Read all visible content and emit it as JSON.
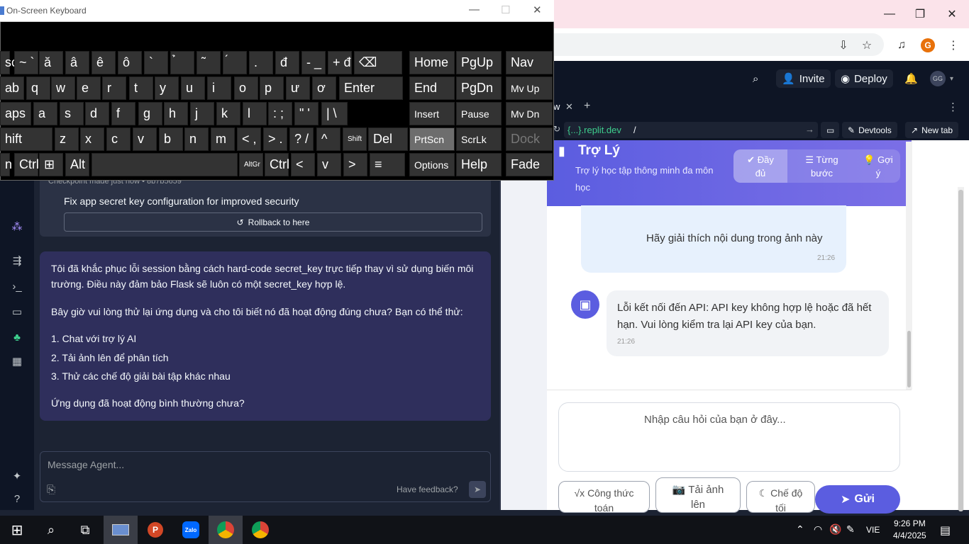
{
  "osk": {
    "title": "On-Screen Keyboard",
    "rows": [
      [
        {
          "l": "sc"
        },
        {
          "l": "~ `"
        },
        {
          "l": "ă"
        },
        {
          "l": "â"
        },
        {
          "l": "ê"
        },
        {
          "l": "ô"
        },
        {
          "l": "`"
        },
        {
          "l": "̉"
        },
        {
          "l": "̃"
        },
        {
          "l": "́"
        },
        {
          "l": "."
        },
        {
          "l": "đ"
        },
        {
          "l": "- _"
        },
        {
          "l": "+ đ"
        },
        {
          "l": "⌫"
        },
        {
          "l": "Home"
        },
        {
          "l": "PgUp"
        },
        {
          "l": "Nav"
        }
      ],
      [
        {
          "l": "ab"
        },
        {
          "l": "q"
        },
        {
          "l": "w"
        },
        {
          "l": "e"
        },
        {
          "l": "r"
        },
        {
          "l": "t"
        },
        {
          "l": "y"
        },
        {
          "l": "u"
        },
        {
          "l": "i"
        },
        {
          "l": "o"
        },
        {
          "l": "p"
        },
        {
          "l": "ư"
        },
        {
          "l": "ơ"
        },
        {
          "l": "Enter"
        },
        {
          "l": "End"
        },
        {
          "l": "PgDn"
        },
        {
          "l": "Mv Up"
        }
      ],
      [
        {
          "l": "aps"
        },
        {
          "l": "a"
        },
        {
          "l": "s"
        },
        {
          "l": "d"
        },
        {
          "l": "f"
        },
        {
          "l": "g"
        },
        {
          "l": "h"
        },
        {
          "l": "j"
        },
        {
          "l": "k"
        },
        {
          "l": "l"
        },
        {
          "l": ": ;"
        },
        {
          "l": "\" '"
        },
        {
          "l": "| \\"
        },
        {
          "l": "Insert"
        },
        {
          "l": "Pause"
        },
        {
          "l": "Mv Dn"
        }
      ],
      [
        {
          "l": "hift"
        },
        {
          "l": "z"
        },
        {
          "l": "x"
        },
        {
          "l": "c"
        },
        {
          "l": "v"
        },
        {
          "l": "b"
        },
        {
          "l": "n"
        },
        {
          "l": "m"
        },
        {
          "l": "< ,"
        },
        {
          "l": "> ."
        },
        {
          "l": "? /"
        },
        {
          "l": "^"
        },
        {
          "l": "Shift"
        },
        {
          "l": "Del"
        },
        {
          "l": "PrtScn"
        },
        {
          "l": "ScrLk"
        },
        {
          "l": "Dock"
        }
      ],
      [
        {
          "l": "n"
        },
        {
          "l": "Ctrl"
        },
        {
          "l": "⊞"
        },
        {
          "l": "Alt"
        },
        {
          "l": ""
        },
        {
          "l": "AltGr"
        },
        {
          "l": "Ctrl"
        },
        {
          "l": "<"
        },
        {
          "l": "v"
        },
        {
          "l": ">"
        },
        {
          "l": "≡"
        },
        {
          "l": "Options"
        },
        {
          "l": "Help"
        },
        {
          "l": "Fade"
        }
      ]
    ]
  },
  "chrome": {
    "minimize": "—",
    "maximize": "❐",
    "close": "✕",
    "profile_letter": "G"
  },
  "replit": {
    "invite": "Invite",
    "deploy": "Deploy",
    "user_initials": "GG",
    "checkpoint_meta": "Checkpoint made just now • 8b7b5659",
    "checkpoint_title": "Fix app secret key configuration for improved security",
    "rollback": "Rollback to here",
    "agent_message": [
      "Tôi đã khắc phục lỗi session bằng cách hard-code secret_key trực tiếp thay vì sử dụng biến môi",
      "trường. Điều này đảm bảo Flask sẽ luôn có một secret_key hợp lệ.",
      "Bây giờ vui lòng thử lại ứng dụng và cho tôi biết nó đã hoạt động đúng chưa? Bạn có thể thử:",
      "1. Chat với trợ lý AI",
      "2. Tải ảnh lên để phân tích",
      "3. Thử các chế độ giải bài tập khác nhau",
      "Ứng dụng đã hoạt động bình thường chưa?"
    ],
    "message_placeholder": "Message Agent...",
    "feedback": "Have feedback?",
    "webview_tab": "w",
    "url_domain": "{...}.replit.dev",
    "url_path": "/",
    "devtools": "Devtools",
    "new_tab": "New tab"
  },
  "app": {
    "title": "Trợ Lý",
    "subtitle": "Trợ lý học tập thông minh đa môn học",
    "modes": [
      {
        "icon": "✔",
        "label1": "Đầy",
        "label2": "đủ"
      },
      {
        "icon": "☰",
        "label1": "Từng",
        "label2": "bước"
      },
      {
        "icon": "💡",
        "label1": "Gợi",
        "label2": "ý"
      }
    ],
    "user_msg": "Hãy giải thích nội dung trong ảnh này",
    "user_time": "21:26",
    "bot_msg": "Lỗi kết nối đến API: API key không hợp lệ hoặc đã hết hạn. Vui lòng kiểm tra lại API key của bạn.",
    "bot_time": "21:26",
    "input_placeholder": "Nhập câu hỏi của bạn ở đây...",
    "btn_formula_1": "√x Công thức",
    "btn_formula_2": "toán",
    "btn_upload_1": "📷 Tải ảnh",
    "btn_upload_2": "lên",
    "btn_level_1": "☾ Chế độ",
    "btn_level_2": "tối",
    "btn_send": "Gửi"
  },
  "taskbar": {
    "lang": "VIE",
    "time": "9:26 PM",
    "date": "4/4/2025"
  }
}
